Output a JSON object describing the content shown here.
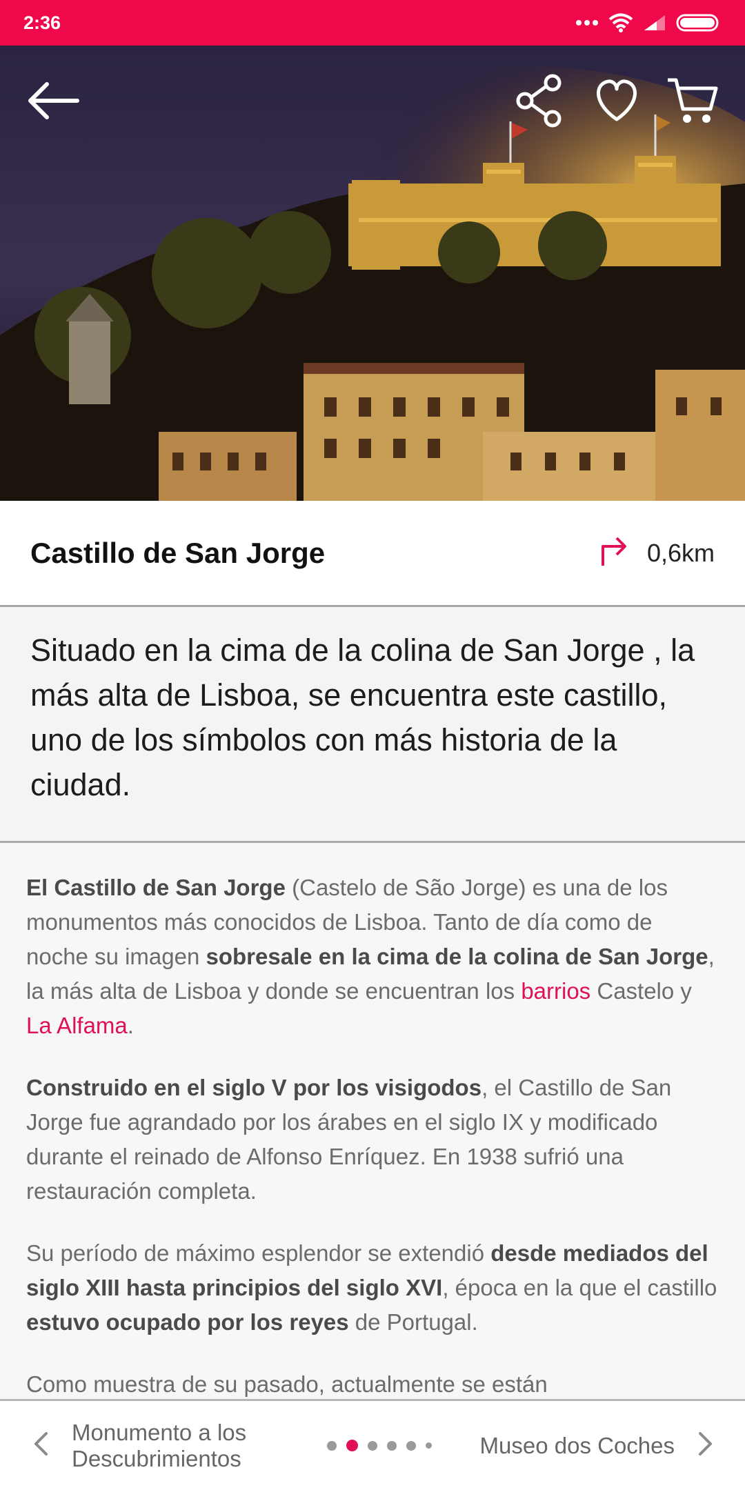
{
  "status_bar": {
    "time": "2:36",
    "icons": [
      "dots-icon",
      "wifi-icon",
      "signal-icon",
      "battery-icon"
    ]
  },
  "hero": {
    "image_description_icon": "castle-photo",
    "actions": [
      "back-arrow-icon",
      "share-icon",
      "heart-icon",
      "cart-icon"
    ]
  },
  "place": {
    "title": "Castillo de San Jorge",
    "distance": "0,6km",
    "distance_icon": "directions-turn-icon"
  },
  "intro": {
    "text": "Situado  en la cima de la colina de San Jorge , la más alta de Lisboa, se encuentra este castillo, uno de los símbolos con más historia de la ciudad."
  },
  "body": {
    "p1": {
      "b1": "El Castillo de San Jorge",
      "t1": " (Castelo de São Jorge) es una de los monumentos más conocidos de Lisboa. Tanto de día como de noche su imagen ",
      "b2": "sobresale en la cima de la colina de San Jorge",
      "t2": ", la más alta de Lisboa y donde se encuentran los ",
      "link1": "barrios",
      "t3": " Castelo y ",
      "link2": "La Alfama",
      "t4": "."
    },
    "p2": {
      "b1": "Construido en el siglo V por los visigodos",
      "t1": ", el Castillo de San Jorge fue agrandado por los árabes en el siglo IX y modificado durante el reinado de Alfonso Enríquez. En 1938 sufrió una restauración completa."
    },
    "p3": {
      "t1": "Su período de máximo esplendor se extendió ",
      "b1": "desde mediados del siglo XIII hasta principios del siglo XVI",
      "t2": ", época en la que el castillo ",
      "b2": "estuvo ocupado por los reyes",
      "t3": " de Portugal."
    },
    "p4": {
      "t1": "Como muestra de su pasado, actualmente se están"
    }
  },
  "bottom_nav": {
    "prev_label": "Monumento a los Descubrimientos",
    "next_label": "Museo dos Coches",
    "pager_total": 6,
    "pager_active_index": 1
  },
  "colors": {
    "accent": "#e0105a",
    "status_bar": "#f0094a"
  }
}
